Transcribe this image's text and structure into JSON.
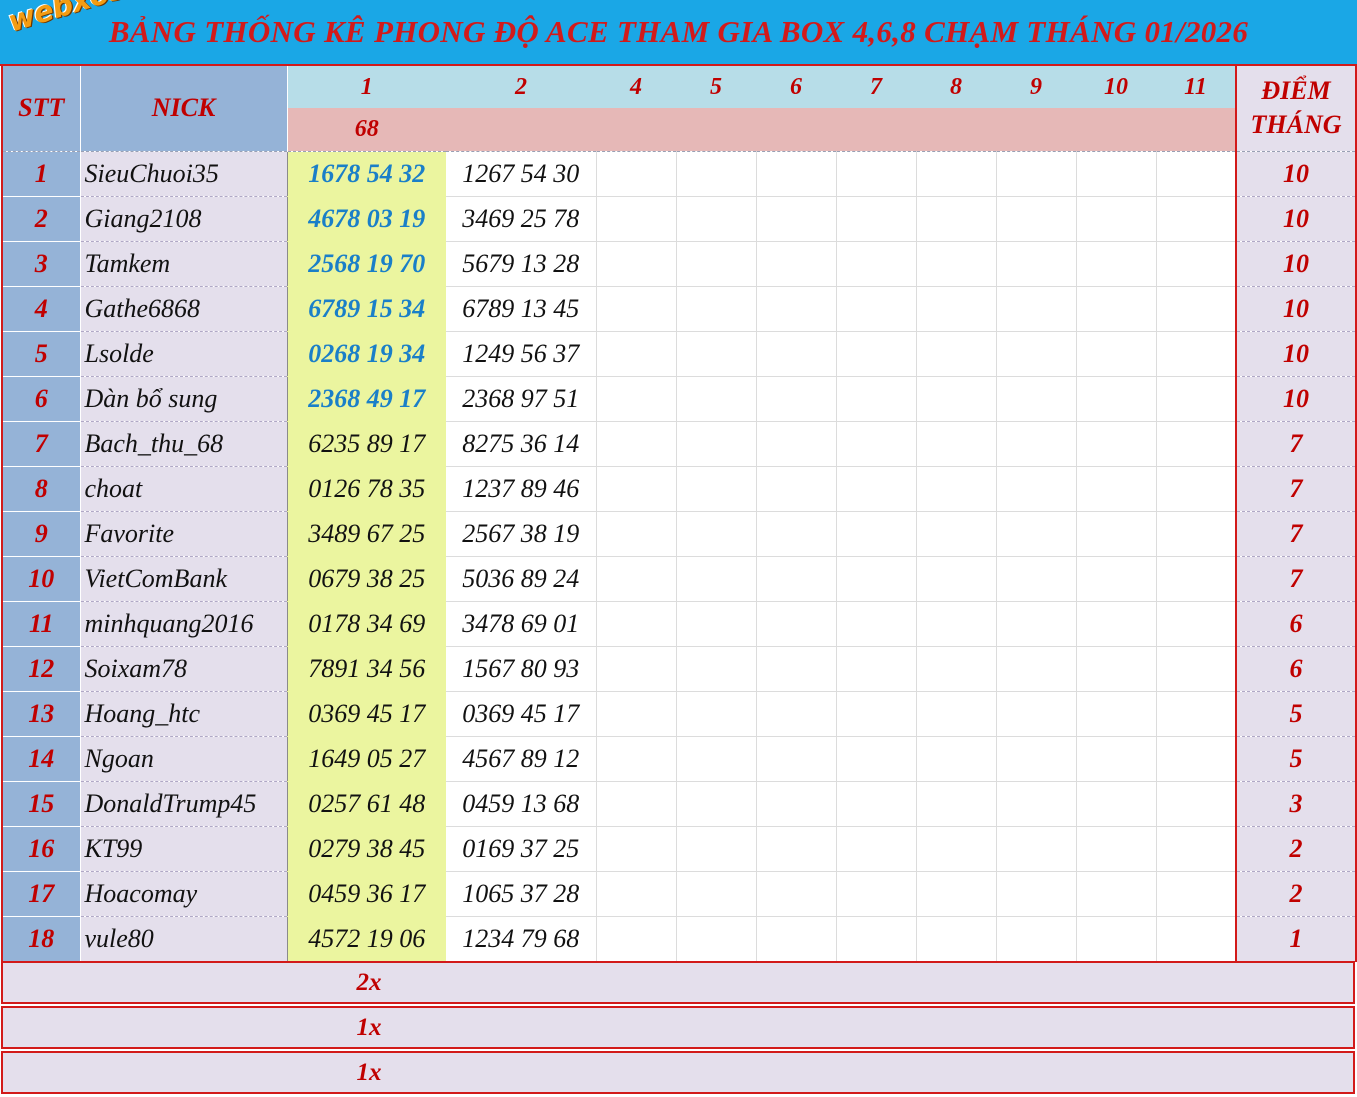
{
  "title": "BẢNG THỐNG KÊ PHONG ĐỘ ACE THAM GIA BOX 4,6,8 CHẠM THÁNG 01/2026",
  "logo": "webxoso.net",
  "header": {
    "stt": "STT",
    "nick": "NICK",
    "days": [
      "1",
      "2",
      "4",
      "5",
      "6",
      "7",
      "8",
      "9",
      "10",
      "11"
    ],
    "day1_result": "68",
    "diem_line1": "ĐIỂM",
    "diem_line2": "THÁNG"
  },
  "rows": [
    {
      "stt": "1",
      "nick": "SieuChuoi35",
      "n1": "1678 54 32",
      "n2": "1267 54 30",
      "diem": "10"
    },
    {
      "stt": "2",
      "nick": "Giang2108",
      "n1": "4678 03 19",
      "n2": "3469 25 78",
      "diem": "10"
    },
    {
      "stt": "3",
      "nick": "Tamkem",
      "n1": "2568 19 70",
      "n2": "5679 13 28",
      "diem": "10"
    },
    {
      "stt": "4",
      "nick": "Gathe6868",
      "n1": "6789 15 34",
      "n2": "6789 13 45",
      "diem": "10"
    },
    {
      "stt": "5",
      "nick": "Lsolde",
      "n1": "0268 19 34",
      "n2": "1249 56 37",
      "diem": "10"
    },
    {
      "stt": "6",
      "nick": "Dàn bổ sung",
      "n1": "2368 49 17",
      "n2": "2368 97 51",
      "diem": "10"
    },
    {
      "stt": "7",
      "nick": "Bach_thu_68",
      "n1": "6235 89 17",
      "n2": "8275 36 14",
      "diem": "7"
    },
    {
      "stt": "8",
      "nick": "choat",
      "n1": "0126 78 35",
      "n2": "1237 89 46",
      "diem": "7"
    },
    {
      "stt": "9",
      "nick": "Favorite",
      "n1": "3489 67 25",
      "n2": "2567 38 19",
      "diem": "7"
    },
    {
      "stt": "10",
      "nick": "VietComBank",
      "n1": "0679 38 25",
      "n2": "5036 89 24",
      "diem": "7"
    },
    {
      "stt": "11",
      "nick": "minhquang2016",
      "n1": "0178 34 69",
      "n2": "3478 69 01",
      "diem": "6"
    },
    {
      "stt": "12",
      "nick": "Soixam78",
      "n1": "7891 34 56",
      "n2": "1567 80 93",
      "diem": "6"
    },
    {
      "stt": "13",
      "nick": "Hoang_htc",
      "n1": "0369 45 17",
      "n2": "0369 45 17",
      "diem": "5"
    },
    {
      "stt": "14",
      "nick": "Ngoan",
      "n1": "1649 05 27",
      "n2": "4567 89 12",
      "diem": "5"
    },
    {
      "stt": "15",
      "nick": "DonaldTrump45",
      "n1": "0257 61 48",
      "n2": "0459 13 68",
      "diem": "3"
    },
    {
      "stt": "16",
      "nick": "KT99",
      "n1": "0279 38 45",
      "n2": "0169 37 25",
      "diem": "2"
    },
    {
      "stt": "17",
      "nick": "Hoacomay",
      "n1": "0459 36 17",
      "n2": "1065 37 28",
      "diem": "2"
    },
    {
      "stt": "18",
      "nick": "vule80",
      "n1": "4572 19 06",
      "n2": "1234 79 68",
      "diem": "1"
    }
  ],
  "footer": [
    "2x",
    "1x",
    "1x"
  ],
  "colors": {
    "accent_red": "#d21a1a",
    "hit_blue": "#1a7fc8",
    "title_bg": "#1aa7e6"
  }
}
